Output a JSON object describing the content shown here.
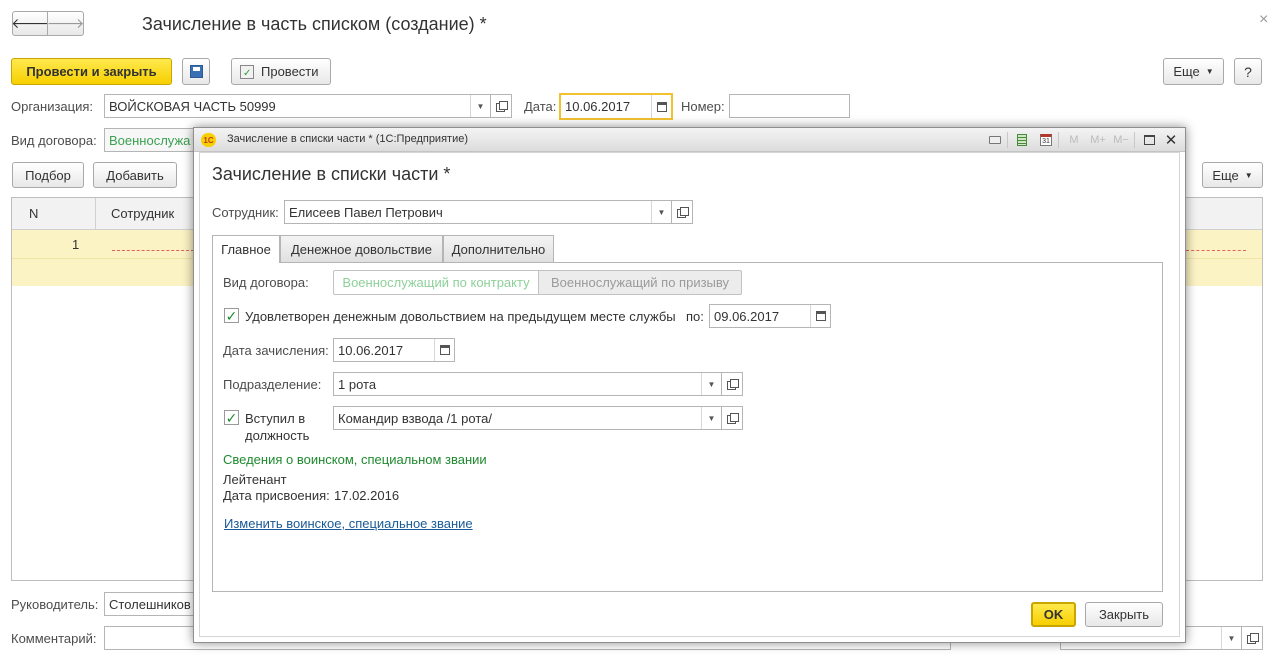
{
  "main": {
    "title": "Зачисление в часть списком (создание) *",
    "close_glyph": "×",
    "nav": {
      "back": "🡐",
      "forward": "🡒"
    },
    "toolbar": {
      "post_close_label": "Провести и закрыть",
      "post_label": "Провести",
      "more_label": "Еще",
      "help_label": "?"
    },
    "org_label": "Организация:",
    "org_value": "ВОЙСКОВАЯ ЧАСТЬ 50999",
    "date_label": "Дата:",
    "date_value": "10.06.2017",
    "number_label": "Номер:",
    "number_value": "",
    "contract_label": "Вид договора:",
    "contract_value": "Военнослужа",
    "table_toolbar": {
      "pick_label": "Подбор",
      "add_label": "Добавить",
      "more_label": "Еще"
    },
    "table": {
      "columns": [
        "N",
        "Сотрудник"
      ],
      "rows": [
        {
          "n": "1"
        }
      ]
    },
    "manager_label": "Руководитель:",
    "manager_value": "Столешников",
    "comment_label": "Комментарий:",
    "comment_value": ""
  },
  "dialog": {
    "window_title": "Зачисление в списки части * (1С:Предприятие)",
    "app_logo": "1С",
    "toolbar_icons": [
      "print-icon",
      "calculator-icon",
      "calendar-icon",
      "memory-m-icon",
      "memory-plus-icon",
      "memory-minus-icon",
      "maximize-icon",
      "close-icon"
    ],
    "memory_labels": {
      "m": "M",
      "m_plus": "M+",
      "m_minus": "M−"
    },
    "heading": "Зачисление в списки части *",
    "employee_label": "Сотрудник:",
    "employee_value": "Елисеев Павел Петрович",
    "tabs": [
      {
        "label": "Главное",
        "active": true
      },
      {
        "label": "Денежное довольствие",
        "active": false
      },
      {
        "label": "Дополнительно",
        "active": false
      }
    ],
    "contract_label": "Вид договора:",
    "contract_options": [
      "Военнослужащий по контракту",
      "Военнослужащий по призыву"
    ],
    "allowance_checkbox_label": "Удовлетворен денежным довольствием на предыдущем месте службы",
    "allowance_checked": true,
    "allowance_until_label": "по:",
    "allowance_until_value": "09.06.2017",
    "enroll_date_label": "Дата зачисления:",
    "enroll_date_value": "10.06.2017",
    "department_label": "Подразделение:",
    "department_value": "1 рота",
    "position_checkbox_label_1": "Вступил в",
    "position_checkbox_label_2": "должность",
    "position_checked": true,
    "position_value": "Командир взвода /1 рота/",
    "rank_section_title": "Сведения о воинском, специальном звании",
    "rank_value": "Лейтенант",
    "rank_date_label": "Дата присвоения:",
    "rank_date_value": "17.02.2016",
    "change_rank_link": "Изменить воинское, специальное звание",
    "ok_label": "OK",
    "close_label": "Закрыть"
  },
  "colors": {
    "accent_yellow": "#f7cf00",
    "link_blue": "#1a5a96",
    "section_green": "#1e8a2e",
    "muted_green": "#7fc08a"
  }
}
